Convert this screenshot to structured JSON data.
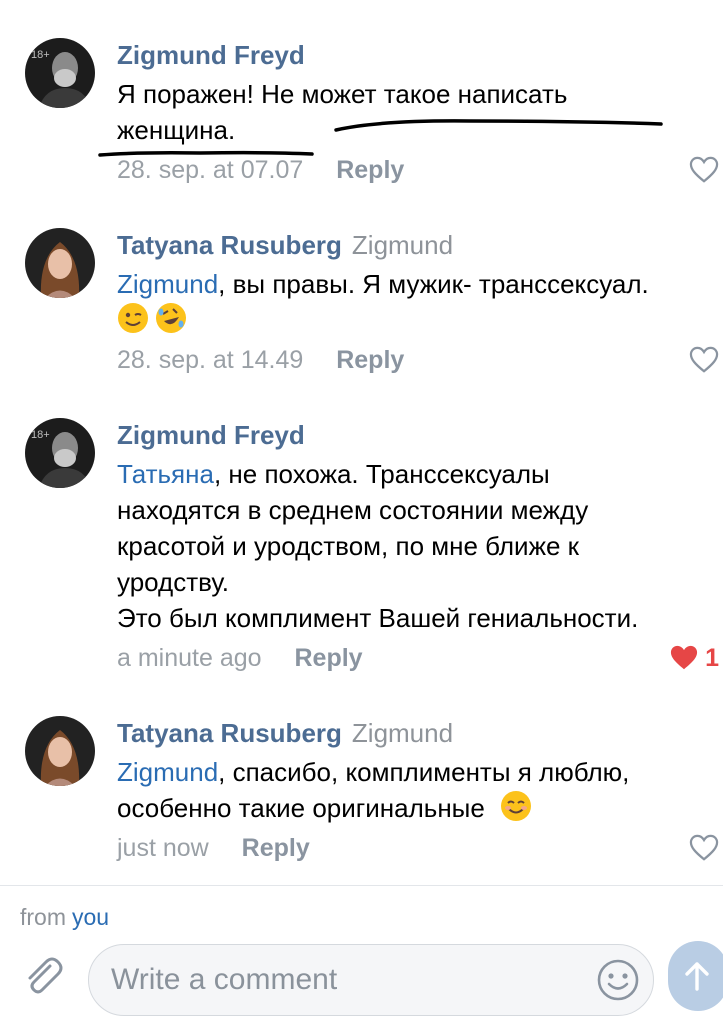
{
  "comments": [
    {
      "author": "Zigmund Freyd",
      "reply_to": "",
      "mention": "",
      "lines": [
        "Я поражен! Не может такое написать",
        "женщина."
      ],
      "time": "28. sep. at 07.07",
      "reply_label": "Reply",
      "liked": false,
      "like_count": "",
      "avatar": "freud-portrait"
    },
    {
      "author": "Tatyana Rusuberg",
      "reply_to": "Zigmund",
      "mention": "Zigmund",
      "lines": [
        ", вы правы. Я мужик- транссексуал."
      ],
      "emojis": [
        "winking-face",
        "rolling-on-floor-laughing"
      ],
      "time": "28. sep. at 14.49",
      "reply_label": "Reply",
      "liked": false,
      "like_count": "",
      "avatar": "woman-portrait"
    },
    {
      "author": "Zigmund Freyd",
      "reply_to": "",
      "mention": "Татьяна",
      "lines": [
        ", не похожа. Транссексуалы",
        "находятся в среднем состоянии между",
        "красотой и уродством, по мне ближе к",
        "уродству.",
        "Это был комплимент Вашей гениальности."
      ],
      "time": "a minute ago",
      "reply_label": "Reply",
      "liked": true,
      "like_count": "1",
      "avatar": "freud-portrait"
    },
    {
      "author": "Tatyana Rusuberg",
      "reply_to": "Zigmund",
      "mention": "Zigmund",
      "lines": [
        ", спасибо, комплименты я люблю,",
        "особенно такие оригинальные"
      ],
      "emojis": [
        "smiling-face"
      ],
      "time": "just now",
      "reply_label": "Reply",
      "liked": false,
      "like_count": "",
      "avatar": "woman-portrait"
    }
  ],
  "avatar_badge": "18+",
  "composer": {
    "from_label": "from",
    "from_value": "you",
    "placeholder": "Write a comment"
  },
  "colors": {
    "author": "#4c6c93",
    "mention": "#2a6cb3",
    "meta": "#9aa0a6",
    "like_active": "#e64646",
    "send_button": "#b9cde4"
  }
}
